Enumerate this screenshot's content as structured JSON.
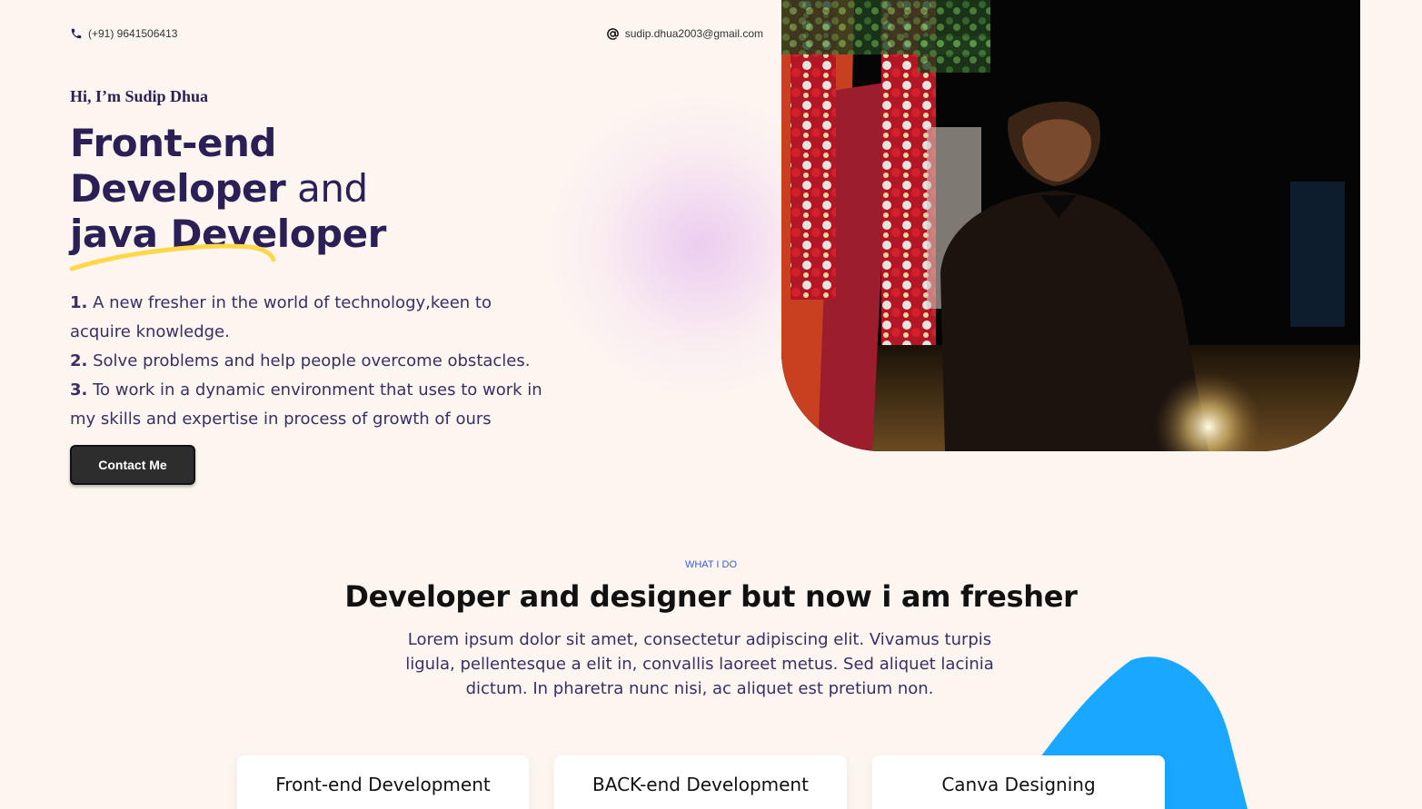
{
  "header": {
    "phone": "(+91) 9641506413",
    "email": "sudip.dhua2003@gmail.com"
  },
  "hero": {
    "greeting": "Hi, I’m Sudip Dhua",
    "headline_line1": "Front-end",
    "headline_line2_bold": "Developer",
    "headline_line2_rest": " and",
    "headline_line3": "java Developer",
    "points": [
      {
        "num": "1.",
        "text": " A new fresher in the world of technology,keen to acquire knowledge."
      },
      {
        "num": "2.",
        "text": " Solve problems and help people overcome obstacles."
      },
      {
        "num": "3.",
        "text": " To work in a dynamic environment that uses to work in my skills and expertise in process of growth of ours"
      }
    ],
    "cta_label": "Contact Me",
    "photo_icon": "profile-photo"
  },
  "services": {
    "tag": "WHAT I DO",
    "title": "Developer and designer but now i am fresher",
    "description": "Lorem ipsum dolor sit amet, consectetur adipiscing elit. Vivamus turpis ligula, pellentesque a elit in, convallis laoreet metus. Sed aliquet lacinia dictum. In pharetra nunc nisi, ac aliquet est pretium non.",
    "cards": [
      {
        "title": "Front-end Development"
      },
      {
        "title": "BACK-end Development"
      },
      {
        "title": "Canva Designing"
      }
    ]
  },
  "colors": {
    "background": "#fdf6f0",
    "primary_text": "#2b1f55",
    "accent_yellow": "#ffd84a",
    "accent_blue": "#1aa7ff",
    "tag_blue": "#3b5bdb",
    "button": "#2d2d2d"
  }
}
